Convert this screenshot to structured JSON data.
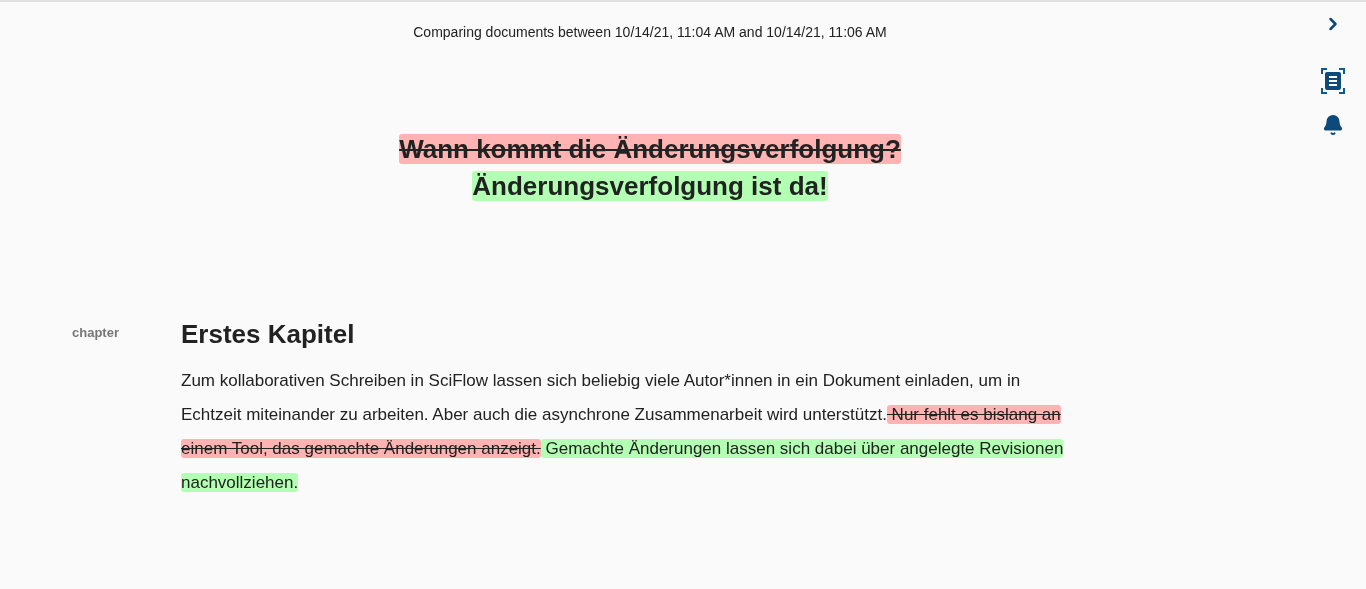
{
  "header": {
    "text": "Comparing documents between 10/14/21, 11:04 AM and 10/14/21, 11:06 AM"
  },
  "title": {
    "segments": [
      {
        "kind": "deleted",
        "text": "Wann kommt die Änderungsverfolgung?"
      },
      {
        "kind": "inserted",
        "text": "Änderungsverfolgung ist da!"
      }
    ]
  },
  "section": {
    "label": "chapter",
    "heading": "Erstes Kapitel",
    "paragraph": [
      {
        "kind": "plain",
        "text": "Zum kollaborativen Schreiben in SciFlow lassen sich beliebig viele Autor*innen in ein Dokument einladen, um in Echtzeit miteinander zu arbeiten. Aber auch die asynchrone Zusammenarbeit wird unterstützt."
      },
      {
        "kind": "deleted",
        "text": " Nur fehlt es bislang an einem Tool, das gemachte Änderungen anzeigt."
      },
      {
        "kind": "inserted",
        "text": " Gemachte Änderungen lassen sich dabei über angelegte Revisionen nachvollziehen."
      }
    ]
  }
}
